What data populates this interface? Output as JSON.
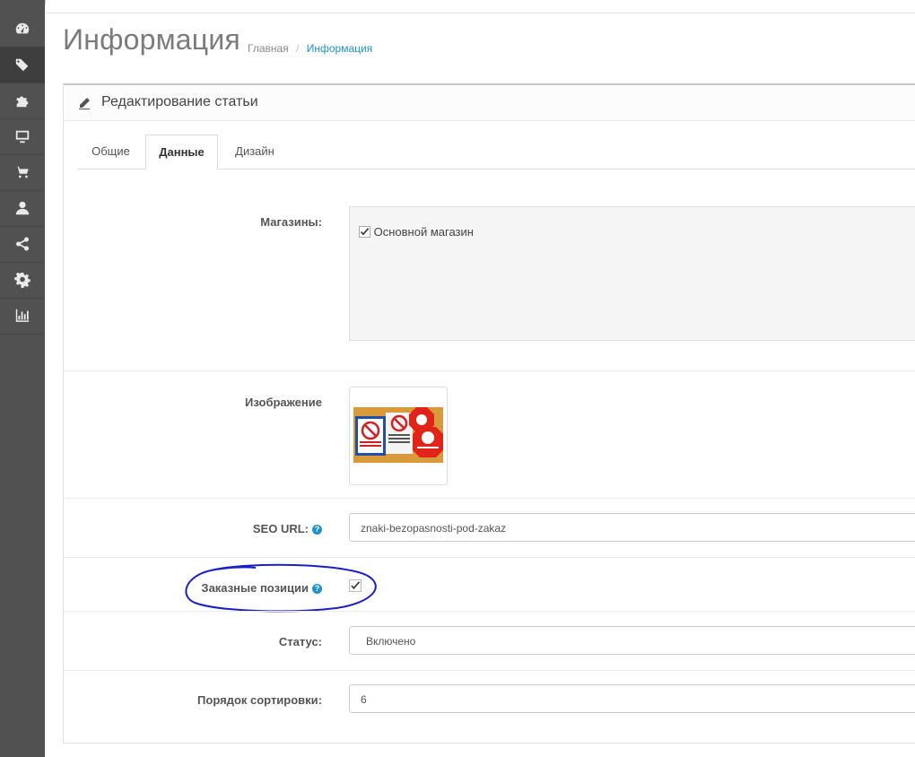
{
  "sidebar": {
    "items": [
      {
        "icon": "dashboard-icon"
      },
      {
        "icon": "tags-icon"
      },
      {
        "icon": "puzzle-icon"
      },
      {
        "icon": "monitor-icon"
      },
      {
        "icon": "shopping-cart-icon"
      },
      {
        "icon": "user-icon"
      },
      {
        "icon": "share-icon"
      },
      {
        "icon": "gear-icon"
      },
      {
        "icon": "bar-chart-icon"
      }
    ]
  },
  "header": {
    "title": "Информация",
    "breadcrumb": {
      "home": "Главная",
      "separator": "/",
      "current": "Информация"
    }
  },
  "panel": {
    "title": "Редактирование статьи"
  },
  "tabs": {
    "general": "Общие",
    "data": "Данные",
    "design": "Дизайн",
    "active": "Данные"
  },
  "form": {
    "stores_label": "Магазины:",
    "store_default": "Основной магазин",
    "image_label": "Изображение",
    "seo_label": "SEO URL:",
    "seo_value": "znaki-bezopasnosti-pod-zakaz",
    "custom_positions_label": "Заказные позиции",
    "custom_positions_checked": true,
    "status_label": "Статус:",
    "status_value": "Включено",
    "sort_label": "Порядок сортировки:",
    "sort_value": "6",
    "help_glyph": "?"
  },
  "colors": {
    "sidebar": "#515151",
    "link": "#1e91cf",
    "annotation": "#1a20c8"
  }
}
